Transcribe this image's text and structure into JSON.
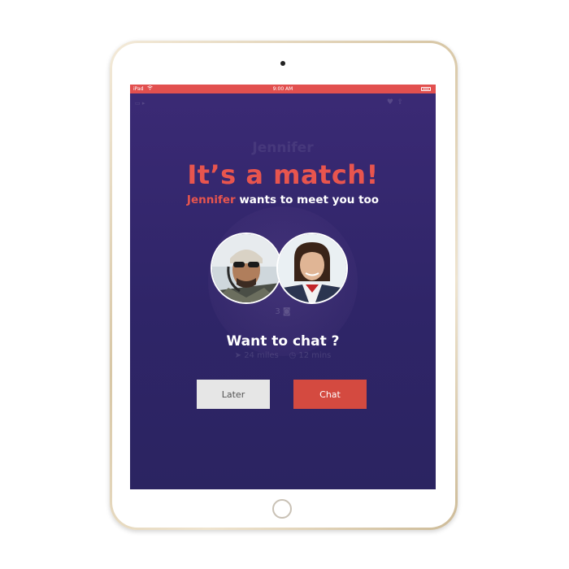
{
  "status_bar": {
    "carrier": "iPad",
    "time": "9:00 AM"
  },
  "background_app": {
    "profile_name": "Jennifer",
    "photo_count": "3",
    "distance": "24 miles",
    "time_ago": "12 mins"
  },
  "match": {
    "title": "It’s a match!",
    "highlight_name": "Jennifer",
    "subtitle_rest": " wants to meet you too",
    "prompt": "Want to chat ?",
    "later_label": "Later",
    "chat_label": "Chat"
  },
  "colors": {
    "accent": "#e8554e",
    "status_bar": "#e2504f",
    "background": "#2f2568",
    "chat_button": "#d44a40",
    "later_button": "#e6e6e6"
  },
  "icons": [
    "wifi-icon",
    "battery-icon",
    "heart-icon",
    "share-icon",
    "camera-icon",
    "location-icon",
    "clock-icon"
  ]
}
